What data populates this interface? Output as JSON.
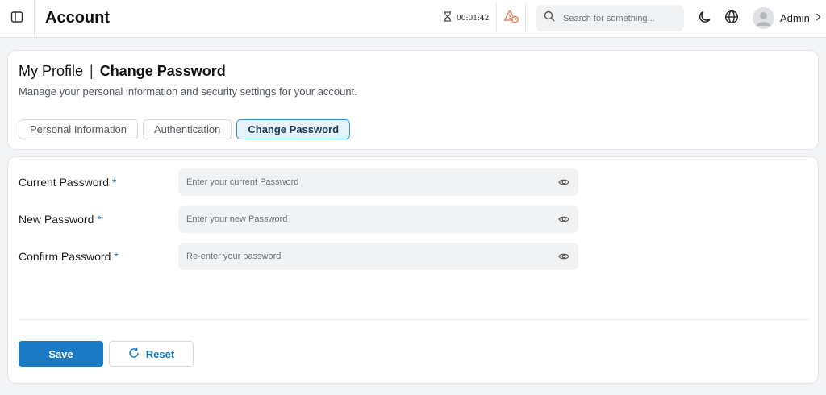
{
  "header": {
    "title": "Account",
    "timer": "00:01:42",
    "search_placeholder": "Search for something...",
    "user_name": "Admin",
    "icons": {
      "sidebar_toggle": "sidebar-panel-icon",
      "timer": "hourglass-icon",
      "alert": "warning-clock-icon",
      "search": "search-icon",
      "theme": "moon-icon",
      "language": "globe-icon",
      "user_menu": "chevron-right-icon"
    }
  },
  "profile": {
    "title": "My Profile",
    "title_separator": "|",
    "section_title": "Change Password",
    "subtitle": "Manage your personal information and security settings for your account.",
    "tabs": [
      {
        "label": "Personal Information",
        "active": false
      },
      {
        "label": "Authentication",
        "active": false
      },
      {
        "label": "Change Password",
        "active": true
      }
    ]
  },
  "form": {
    "required_marker": "*",
    "fields": [
      {
        "label": "Current Password",
        "placeholder": "Enter your current Password",
        "value": ""
      },
      {
        "label": "New Password",
        "placeholder": "Enter your new Password",
        "value": ""
      },
      {
        "label": "Confirm Password",
        "placeholder": "Re-enter your password",
        "value": ""
      }
    ],
    "save_label": "Save",
    "reset_label": "Reset"
  },
  "colors": {
    "accent": "#1a7bc4",
    "alert": "#e8734a",
    "active_tab_bg": "#e7f3fc"
  }
}
